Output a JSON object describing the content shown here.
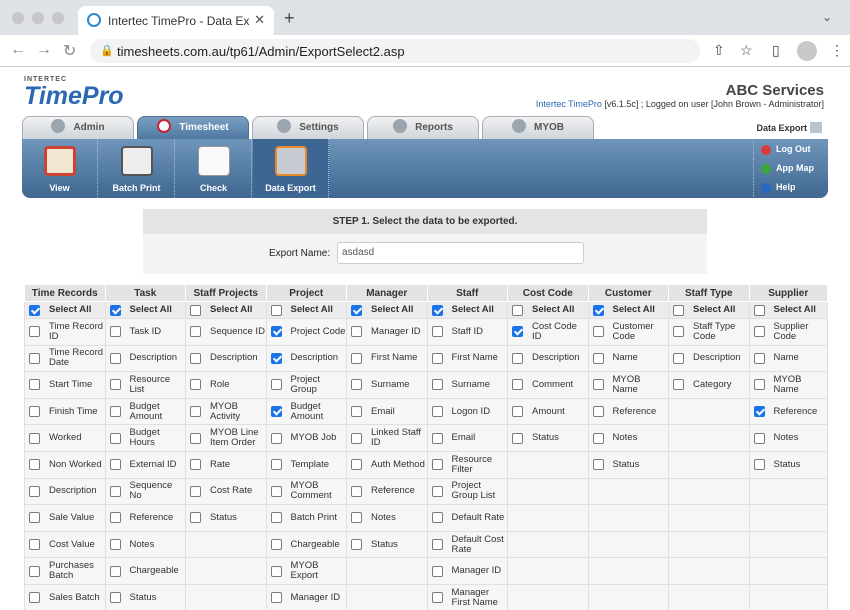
{
  "browser": {
    "tab_title": "Intertec TimePro - Data Export",
    "url": "timesheets.com.au/tp61/Admin/ExportSelect2.asp"
  },
  "header": {
    "logo_small": "INTERTEC",
    "logo_main": "TimePro",
    "company": "ABC Services",
    "app_link": "Intertec TimePro",
    "version_text": "[v6.1.5c] ; Logged on user [John Brown - Administrator]"
  },
  "tabs": [
    {
      "label": "Admin"
    },
    {
      "label": "Timesheet"
    },
    {
      "label": "Settings"
    },
    {
      "label": "Reports"
    },
    {
      "label": "MYOB"
    }
  ],
  "data_export_label": "Data Export",
  "subnav": [
    {
      "label": "View"
    },
    {
      "label": "Batch Print"
    },
    {
      "label": "Check"
    },
    {
      "label": "Data Export"
    }
  ],
  "right_links": [
    {
      "label": "Log Out",
      "color": "#d93a3a"
    },
    {
      "label": "App Map",
      "color": "#3aa63a"
    },
    {
      "label": "Help",
      "color": "#2a68c8"
    }
  ],
  "step": {
    "title": "STEP 1. Select the data to be exported.",
    "name_label": "Export Name:",
    "name_value": "asdasd"
  },
  "select_all_label": "Select All",
  "columns": [
    {
      "header": "Time Records",
      "select_all": true,
      "fields": [
        {
          "label": "Time Record ID",
          "checked": false
        },
        {
          "label": "Time Record Date",
          "checked": false
        },
        {
          "label": "Start Time",
          "checked": false
        },
        {
          "label": "Finish Time",
          "checked": false
        },
        {
          "label": "Worked",
          "checked": false
        },
        {
          "label": "Non Worked",
          "checked": false
        },
        {
          "label": "Description",
          "checked": false
        },
        {
          "label": "Sale Value",
          "checked": false
        },
        {
          "label": "Cost Value",
          "checked": false
        },
        {
          "label": "Purchases Batch",
          "checked": false
        },
        {
          "label": "Sales Batch",
          "checked": false
        }
      ]
    },
    {
      "header": "Task",
      "select_all": true,
      "fields": [
        {
          "label": "Task ID",
          "checked": false
        },
        {
          "label": "Description",
          "checked": false
        },
        {
          "label": "Resource List",
          "checked": false
        },
        {
          "label": "Budget Amount",
          "checked": false
        },
        {
          "label": "Budget Hours",
          "checked": false
        },
        {
          "label": "External ID",
          "checked": false
        },
        {
          "label": "Sequence No",
          "checked": false
        },
        {
          "label": "Reference",
          "checked": false
        },
        {
          "label": "Notes",
          "checked": false
        },
        {
          "label": "Chargeable",
          "checked": false
        },
        {
          "label": "Status",
          "checked": false
        }
      ]
    },
    {
      "header": "Staff Projects",
      "select_all": false,
      "fields": [
        {
          "label": "Sequence ID",
          "checked": false
        },
        {
          "label": "Description",
          "checked": false
        },
        {
          "label": "Role",
          "checked": false
        },
        {
          "label": "MYOB Activity",
          "checked": false
        },
        {
          "label": "MYOB Line Item Order",
          "checked": false
        },
        {
          "label": "Rate",
          "checked": false
        },
        {
          "label": "Cost Rate",
          "checked": false
        },
        {
          "label": "Status",
          "checked": false
        }
      ]
    },
    {
      "header": "Project",
      "select_all": false,
      "fields": [
        {
          "label": "Project Code",
          "checked": true
        },
        {
          "label": "Description",
          "checked": true
        },
        {
          "label": "Project Group",
          "checked": false
        },
        {
          "label": "Budget Amount",
          "checked": true
        },
        {
          "label": "MYOB Job",
          "checked": false
        },
        {
          "label": "Template",
          "checked": false
        },
        {
          "label": "MYOB Comment",
          "checked": false
        },
        {
          "label": "Batch Print",
          "checked": false
        },
        {
          "label": "Chargeable",
          "checked": false
        },
        {
          "label": "MYOB Export",
          "checked": false
        },
        {
          "label": "Manager ID",
          "checked": false
        }
      ]
    },
    {
      "header": "Manager",
      "select_all": true,
      "fields": [
        {
          "label": "Manager ID",
          "checked": false
        },
        {
          "label": "First Name",
          "checked": false
        },
        {
          "label": "Surname",
          "checked": false
        },
        {
          "label": "Email",
          "checked": false
        },
        {
          "label": "Linked Staff ID",
          "checked": false
        },
        {
          "label": "Auth Method",
          "checked": false
        },
        {
          "label": "Reference",
          "checked": false
        },
        {
          "label": "Notes",
          "checked": false
        },
        {
          "label": "Status",
          "checked": false
        }
      ]
    },
    {
      "header": "Staff",
      "select_all": true,
      "fields": [
        {
          "label": "Staff ID",
          "checked": false
        },
        {
          "label": "First Name",
          "checked": false
        },
        {
          "label": "Surname",
          "checked": false
        },
        {
          "label": "Logon ID",
          "checked": false
        },
        {
          "label": "Email",
          "checked": false
        },
        {
          "label": "Resource Filter",
          "checked": false
        },
        {
          "label": "Project Group List",
          "checked": false
        },
        {
          "label": "Default Rate",
          "checked": false
        },
        {
          "label": "Default Cost Rate",
          "checked": false
        },
        {
          "label": "Manager ID",
          "checked": false
        },
        {
          "label": "Manager First Name",
          "checked": false
        }
      ]
    },
    {
      "header": "Cost Code",
      "select_all": false,
      "fields": [
        {
          "label": "Cost Code ID",
          "checked": true
        },
        {
          "label": "Description",
          "checked": false
        },
        {
          "label": "Comment",
          "checked": false
        },
        {
          "label": "Amount",
          "checked": false
        },
        {
          "label": "Status",
          "checked": false
        }
      ]
    },
    {
      "header": "Customer",
      "select_all": true,
      "fields": [
        {
          "label": "Customer Code",
          "checked": false
        },
        {
          "label": "Name",
          "checked": false
        },
        {
          "label": "MYOB Name",
          "checked": false
        },
        {
          "label": "Reference",
          "checked": false
        },
        {
          "label": "Notes",
          "checked": false
        },
        {
          "label": "Status",
          "checked": false
        }
      ]
    },
    {
      "header": "Staff Type",
      "select_all": false,
      "fields": [
        {
          "label": "Staff Type Code",
          "checked": false
        },
        {
          "label": "Description",
          "checked": false
        },
        {
          "label": "Category",
          "checked": false
        }
      ]
    },
    {
      "header": "Supplier",
      "select_all": false,
      "fields": [
        {
          "label": "Supplier Code",
          "checked": false
        },
        {
          "label": "Name",
          "checked": false
        },
        {
          "label": "MYOB Name",
          "checked": false
        },
        {
          "label": "Reference",
          "checked": true
        },
        {
          "label": "Notes",
          "checked": false
        },
        {
          "label": "Status",
          "checked": false
        }
      ]
    }
  ]
}
